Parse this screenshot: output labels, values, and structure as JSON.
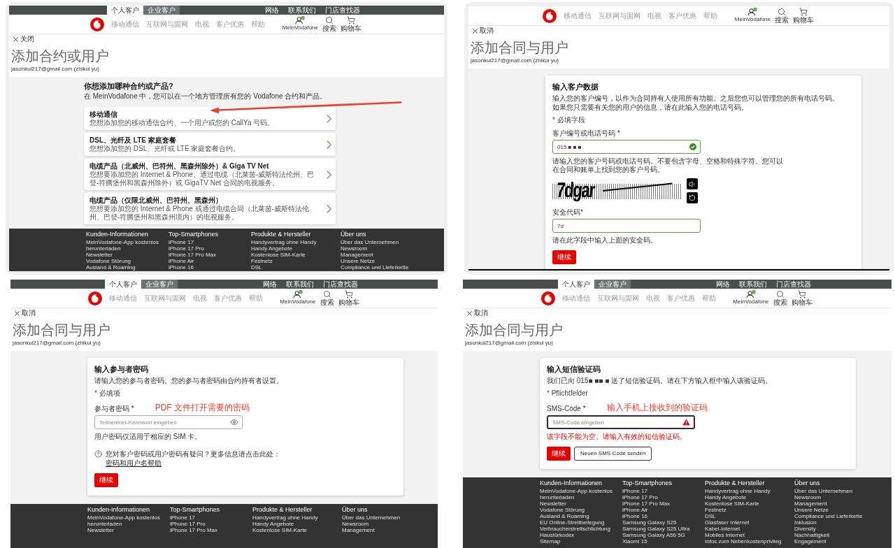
{
  "panels": [
    {
      "top_bar": {
        "tabs": [
          {
            "label": "个人客户",
            "selected": true
          },
          {
            "label": "企业客户",
            "selected": false
          }
        ],
        "links": [
          "网络",
          "联系我们",
          "门店查找器"
        ]
      },
      "nav": {
        "items": [
          "移动通信",
          "互联网与固网",
          "电视",
          "客户优惠",
          "帮助"
        ],
        "actions": [
          {
            "kind": "account",
            "label": "MeinVodafone"
          },
          {
            "kind": "search",
            "label": "搜索"
          },
          {
            "kind": "cart",
            "label": "购物车"
          }
        ]
      },
      "close_label": "关闭",
      "title": "添加合约或用户",
      "account": "jasonkui217@gmail.com (zhikui yu)",
      "content": {
        "kind": "choice",
        "heading": "你想添加哪种合约或产品?",
        "intro": "在 MeinVodafone 中，您可以在一个地方管理所有您的 Vodafone 合约和产品。",
        "pointer_arrow": true,
        "options": [
          {
            "title": "移动通信",
            "description": "您想添加您的移动通信合约、一个用户或您的 CallYa 号码。"
          },
          {
            "title": "DSL、光纤及 LTE 家庭套餐",
            "description": "您想添加您的 DSL、光纤或 LTE 家庭套餐合约。"
          },
          {
            "title": "电缆产品（北威州、巴符州、黑森州除外）& Giga TV Net",
            "description": "您想要添加您的 Internet & Phone、通过电缆（北莱茵-威斯特法伦州、巴登-符腾堡州和黑森州除外）或 GigaTV Net 合同的电视服务。"
          },
          {
            "title": "电缆产品（仅限北威州、巴符州、黑森州）",
            "description": "您想要添加您的 Internet & Phone 或通过电缆合同（北莱茵-威斯特法伦州、巴登-符腾堡州和黑森州境内）的电视服务。"
          }
        ]
      },
      "footer": [
        {
          "heading": "Kunden-Informationen",
          "links": [
            "MeinVodafone-App kostenlos",
            "herunterladen",
            "Newsletter",
            "Vodafone Störung",
            "Ausland & Roaming"
          ]
        },
        {
          "heading": "Top-Smartphones",
          "links": [
            "iPhone 17",
            "iPhone 17 Pro",
            "iPhone 17 Pro Max",
            "iPhone Air",
            "iPhone 16"
          ]
        },
        {
          "heading": "Produkte & Hersteller",
          "links": [
            "Handyvertrag ohne Handy",
            "Handy Angebote",
            "Kostenlose SIM-Karte",
            "Festnetz",
            "DSL"
          ]
        },
        {
          "heading": "Über uns",
          "links": [
            "Über das Unternehmen",
            "Newsroom",
            "Management",
            "Unsere Netze",
            "Compliance und Lieferkette"
          ]
        }
      ]
    },
    {
      "nav": {
        "items": [
          "移动通信",
          "互联网与固网",
          "电视",
          "客户优惠",
          "帮助"
        ],
        "actions": [
          {
            "kind": "account",
            "label": "MeinVodafone"
          },
          {
            "kind": "search",
            "label": "搜索"
          },
          {
            "kind": "cart",
            "label": "购物车"
          }
        ]
      },
      "close_label": "取消",
      "title": "添加合同与用户",
      "account": "jasonkui217@gmail.com (zhikui yu)",
      "content": {
        "kind": "form",
        "heading": "输入客户数据",
        "intro": [
          "输入您的客户编号，以作为合同持有人使用所有功能。之后您也可以管理您的所有电话号码。",
          "如果您只需要有关您的用户的信息，请在此输入您的电话号码。"
        ],
        "required_note": "* 必填字段",
        "fields": [
          {
            "kind": "text",
            "label": "客户编号或电话号码 *",
            "value": "015 ■ ■ ■",
            "valid": true,
            "confirmed": true,
            "hint": "请输入您的客户号码或电话号码。不要包含字母、空格和特殊字符。您可以在合同和账单上找到您的客户号码。"
          },
          {
            "kind": "captcha",
            "text": "7dgar"
          },
          {
            "kind": "text",
            "label": "安全代码*",
            "value": "7d",
            "valid": true,
            "confirmed": false,
            "hint": "请在此字段中输入上面的安全码。"
          }
        ],
        "buttons": [
          {
            "kind": "primary",
            "label": "继续"
          }
        ]
      }
    },
    {
      "top_bar": {
        "tabs": [
          {
            "label": "个人客户",
            "selected": true
          },
          {
            "label": "企业客户",
            "selected": false
          }
        ],
        "links": [
          "网络",
          "联系我们",
          "门店查找器"
        ]
      },
      "nav": {
        "items": [
          "移动通信",
          "互联网与固网",
          "电视",
          "客户优惠",
          "帮助"
        ],
        "actions": [
          {
            "kind": "account",
            "label": "MeinVodafone"
          },
          {
            "kind": "search",
            "label": "搜索"
          },
          {
            "kind": "cart",
            "label": "购物车"
          }
        ]
      },
      "close_label": "取消",
      "title": "添加合同与用户",
      "account": "jasonkui217@gmail.com (zhikui yu)",
      "content": {
        "kind": "form",
        "heading": "输入参与者密码",
        "intro": [
          "请输入您的参与者密码。您的参与者密码由合约持有者设置。"
        ],
        "required_note": "* 必填项",
        "fields": [
          {
            "kind": "password",
            "label": "参与者密码 *",
            "annotation": "PDF 文件打开需要的密码",
            "placeholder": "Teilnehmer-Kennwort eingeben",
            "valid": false,
            "hint": "用户密码仅适用于相应的 SIM 卡。"
          }
        ],
        "help": {
          "text": "您对客户密码或用户密码有疑问？更多信息请点击此处：",
          "link": "密码和用户名帮助"
        },
        "buttons": [
          {
            "kind": "primary",
            "label": "继续"
          }
        ]
      },
      "footer": [
        {
          "heading": "Kunden-Informationen",
          "links": [
            "MeinVodafone-App kostenlos",
            "herunterladen",
            "Newsletter"
          ]
        },
        {
          "heading": "Top-Smartphones",
          "links": [
            "iPhone 17",
            "iPhone 17 Pro",
            "iPhone 17 Pro Max"
          ]
        },
        {
          "heading": "Produkte & Hersteller",
          "links": [
            "Handyvertrag ohne Handy",
            "Handy Angebote",
            "Kostenlose SIM-Karte"
          ]
        },
        {
          "heading": "Über uns",
          "links": [
            "Über das Unternehmen",
            "Newsroom",
            "Management"
          ]
        }
      ]
    },
    {
      "top_bar": {
        "tabs": [
          {
            "label": "个人客户",
            "selected": true
          },
          {
            "label": "企业客户",
            "selected": false
          }
        ],
        "links": [
          "网络",
          "联系我们",
          "门店查找器"
        ]
      },
      "nav": {
        "items": [
          "移动通信",
          "互联网与固网",
          "电视",
          "客户优惠",
          "帮助"
        ],
        "actions": [
          {
            "kind": "account",
            "label": "MeinVodafone"
          },
          {
            "kind": "search",
            "label": "搜索"
          },
          {
            "kind": "cart",
            "label": "购物车"
          }
        ]
      },
      "close_label": "取消",
      "title": "添加合同与用户",
      "account": "jasonkui217@gmail.com (zhikui yu)",
      "content": {
        "kind": "form",
        "heading": "输入短信验证码",
        "intro": [
          "我们已向 015■ ■■ ■ 送了短信验证码。请在下方输入框中输入该验证码。"
        ],
        "required_note": "* Pflichtfelder",
        "fields": [
          {
            "kind": "text",
            "label": "SMS-Code *",
            "annotation": "输入手机上接收到的验证码",
            "placeholder": "SMS-Code eingeben",
            "error": "该字段不能为空。请输入有效的短信验证码。"
          }
        ],
        "buttons": [
          {
            "kind": "primary",
            "label": "继续"
          },
          {
            "kind": "secondary",
            "label": "Neuen SMS-Code senden"
          }
        ]
      },
      "footer": [
        {
          "heading": "Kunden-Informationen",
          "links": [
            "MeinVodafone-App kostenlos",
            "herunterladen",
            "Newsletter",
            "Vodafone Störung",
            "Ausland & Roaming",
            "EU Online-Streitbeilegung",
            "Verbraucherstreitschlichtung",
            "Haustürkodex",
            "Sitemap"
          ]
        },
        {
          "heading": "Top-Smartphones",
          "links": [
            "iPhone 17",
            "iPhone 17 Pro",
            "iPhone 17 Pro Max",
            "iPhone Air",
            "iPhone 16",
            "Samsung Galaxy S25",
            "Samsung Galaxy S25 Ultra",
            "Samsung Galaxy A56 5G",
            "Xiaomi 15"
          ]
        },
        {
          "heading": "Produkte & Hersteller",
          "links": [
            "Handyvertrag ohne Handy",
            "Handy Angebote",
            "Kostenlose SIM-Karte",
            "Festnetz",
            "DSL",
            "Glasfaser Internet",
            "Kabel-Internet",
            "Mobiles Internet",
            "Infos zum Nebenkostenprivileg"
          ]
        },
        {
          "heading": "Über uns",
          "links": [
            "Über das Unternehmen",
            "Newsroom",
            "Management",
            "Unsere Netze",
            "Compliance und Lieferkette",
            "Inklusion",
            "Diversity",
            "Nachhaltigkeit",
            "Engagement"
          ]
        }
      ]
    }
  ]
}
